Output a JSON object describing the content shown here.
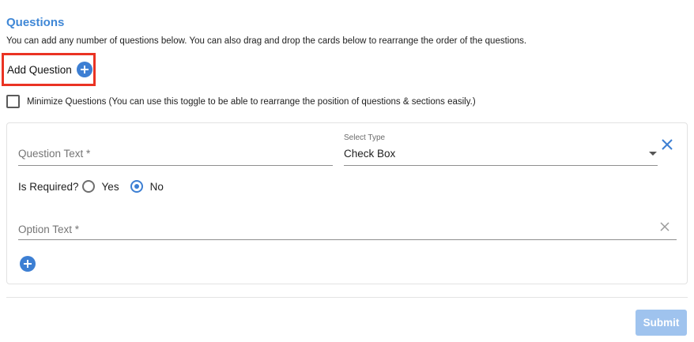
{
  "section": {
    "title": "Questions",
    "description": "You can add any number of questions below. You can also drag and drop the cards below to rearrange the order of the questions."
  },
  "add_question": {
    "label": "Add Question",
    "icon": "plus-circle-icon",
    "highlight_color": "#ea3323"
  },
  "minimize": {
    "checked": false,
    "label": "Minimize Questions (You can use this toggle to be able to rearrange the position of questions & sections easily.)"
  },
  "question_card": {
    "question_text": {
      "placeholder": "Question Text *",
      "value": ""
    },
    "select_type": {
      "label": "Select Type",
      "value": "Check Box"
    },
    "is_required": {
      "label": "Is Required?",
      "options": [
        {
          "label": "Yes",
          "selected": false
        },
        {
          "label": "No",
          "selected": true
        }
      ]
    },
    "option_text": {
      "placeholder": "Option Text *",
      "value": ""
    }
  },
  "submit": {
    "label": "Submit",
    "disabled": true
  },
  "colors": {
    "accent": "#3d7fd3",
    "title": "#3f87d6",
    "submit_disabled": "#9fc3ee"
  }
}
